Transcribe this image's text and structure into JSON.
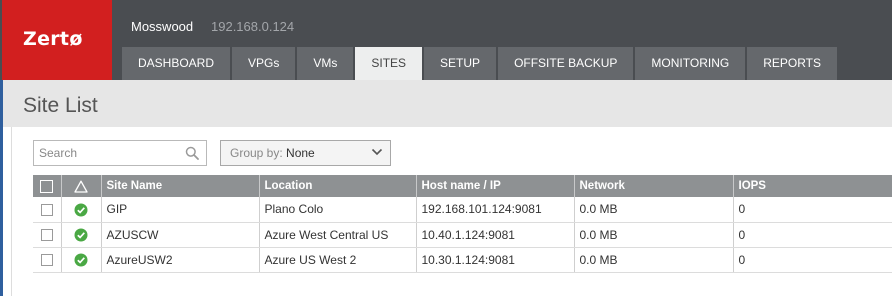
{
  "app": {
    "logo": "Zertø",
    "site_name": "Mosswood",
    "site_ip": "192.168.0.124"
  },
  "tabs": [
    {
      "label": "DASHBOARD",
      "active": false
    },
    {
      "label": "VPGs",
      "active": false
    },
    {
      "label": "VMs",
      "active": false
    },
    {
      "label": "SITES",
      "active": true
    },
    {
      "label": "SETUP",
      "active": false
    },
    {
      "label": "OFFSITE BACKUP",
      "active": false
    },
    {
      "label": "MONITORING",
      "active": false
    },
    {
      "label": "REPORTS",
      "active": false
    }
  ],
  "page": {
    "title": "Site List"
  },
  "search": {
    "placeholder": "Search",
    "value": ""
  },
  "groupby": {
    "label": "Group by:",
    "value": "None"
  },
  "table": {
    "columns": [
      "Site Name",
      "Location",
      "Host name / IP",
      "Network",
      "IOPS"
    ],
    "rows": [
      {
        "site": "GIP",
        "location": "Plano Colo",
        "host": "192.168.101.124:9081",
        "network": "0.0 MB",
        "iops": "0",
        "status": "ok"
      },
      {
        "site": "AZUSCW",
        "location": "Azure West Central US",
        "host": "10.40.1.124:9081",
        "network": "0.0 MB",
        "iops": "0",
        "status": "ok"
      },
      {
        "site": "AzureUSW2",
        "location": "Azure US West 2",
        "host": "10.30.1.124:9081",
        "network": "0.0 MB",
        "iops": "0",
        "status": "ok"
      }
    ]
  },
  "icons": {
    "search": "search-icon",
    "dropdown": "chevron-down-icon",
    "alert_header": "alert-triangle-icon",
    "status_ok": "check-circle-icon"
  },
  "colors": {
    "brand_red": "#d21f1f",
    "topbar": "#4a4d51",
    "tab": "#65686c",
    "tab_active": "#edeeee",
    "status_ok": "#4aa844",
    "table_header": "#8e9193"
  }
}
